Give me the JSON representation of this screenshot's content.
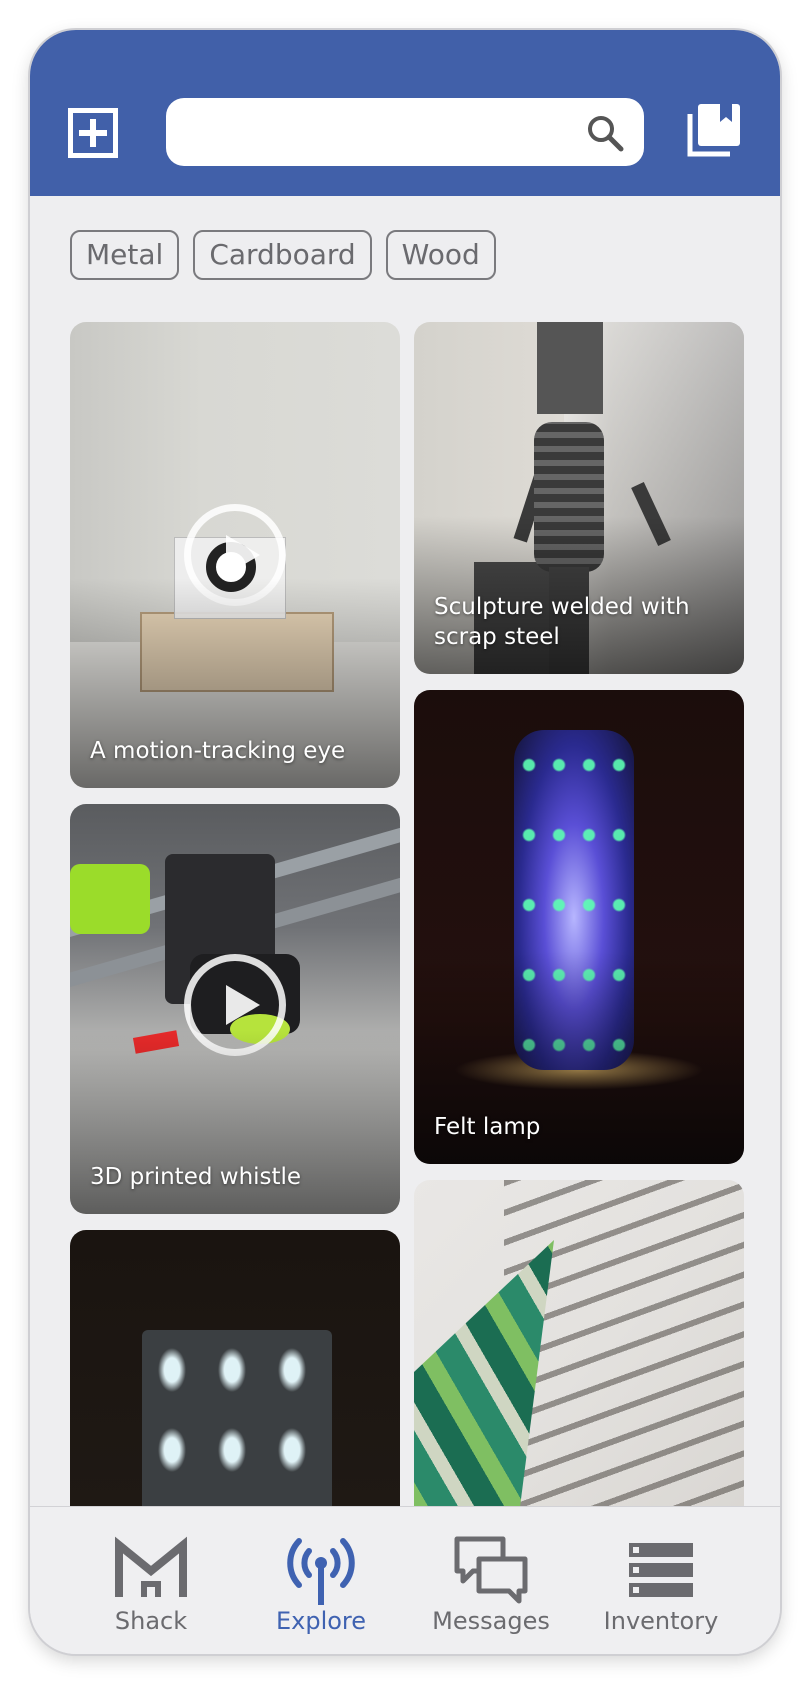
{
  "header": {
    "search": {
      "placeholder": "",
      "value": ""
    }
  },
  "filters": [
    "Metal",
    "Cardboard",
    "Wood"
  ],
  "feed": {
    "cards": [
      {
        "caption": "A motion-tracking eye",
        "video": true
      },
      {
        "caption": "Sculpture welded with scrap steel",
        "video": false
      },
      {
        "caption": "3D printed whistle",
        "video": true
      },
      {
        "caption": "Felt lamp",
        "video": false
      },
      {
        "caption": "",
        "video": false
      },
      {
        "caption": "",
        "video": false
      }
    ]
  },
  "tabs": [
    {
      "label": "Shack",
      "icon": "shack-icon",
      "active": false
    },
    {
      "label": "Explore",
      "icon": "broadcast-icon",
      "active": true
    },
    {
      "label": "Messages",
      "icon": "chat-icon",
      "active": false
    },
    {
      "label": "Inventory",
      "icon": "list-icon",
      "active": false
    }
  ],
  "colors": {
    "brand": "#4160a9",
    "active_tab": "#3f62b1",
    "inactive_tab": "#6b6b6f",
    "background": "#eeeef0"
  }
}
